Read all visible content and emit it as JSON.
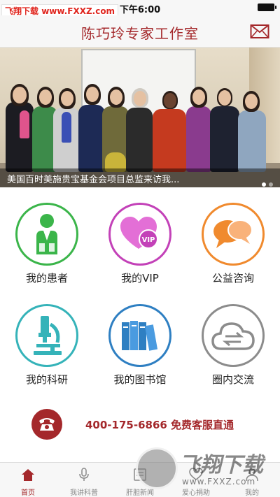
{
  "status_bar": {
    "time": "下午6:00",
    "watermark_text_a": "飞翔下载",
    "watermark_text_b": " www.FXXZ.com"
  },
  "header": {
    "title": "陈巧玲专家工作室",
    "mail_icon": "mail-icon"
  },
  "banner": {
    "caption": "美国百时美施贵宝基金会项目总监来访我...",
    "dots": 2,
    "active_dot": 1
  },
  "grid": [
    {
      "label": "我的患者",
      "icon": "doctor-icon",
      "color": "#3bb54a"
    },
    {
      "label": "我的VIP",
      "icon": "vip-heart-icon",
      "color": "#c341b8"
    },
    {
      "label": "公益咨询",
      "icon": "chat-bubbles-icon",
      "color": "#f08a2e"
    },
    {
      "label": "我的科研",
      "icon": "microscope-icon",
      "color": "#35b3b9"
    },
    {
      "label": "我的图书馆",
      "icon": "books-icon",
      "color": "#2e7fc2"
    },
    {
      "label": "圈内交流",
      "icon": "cloud-exchange-icon",
      "color": "#8c8c8c"
    }
  ],
  "hotline": {
    "text": "400-175-6866  免费客服直通",
    "icon": "telephone-icon"
  },
  "tabbar": [
    {
      "label": "首页",
      "icon": "home-icon",
      "active": true
    },
    {
      "label": "我讲科普",
      "icon": "microphone-icon",
      "active": false
    },
    {
      "label": "肝胆新闻",
      "icon": "news-icon",
      "active": false
    },
    {
      "label": "爱心捐助",
      "icon": "donate-icon",
      "active": false
    },
    {
      "label": "我的",
      "icon": "profile-icon",
      "active": false
    }
  ],
  "watermark_bottom": {
    "brand": "飞翔下载",
    "url": "www.FXXZ.com"
  },
  "colors": {
    "brand": "#a4282b",
    "tab_inactive": "#8a8a8a"
  }
}
